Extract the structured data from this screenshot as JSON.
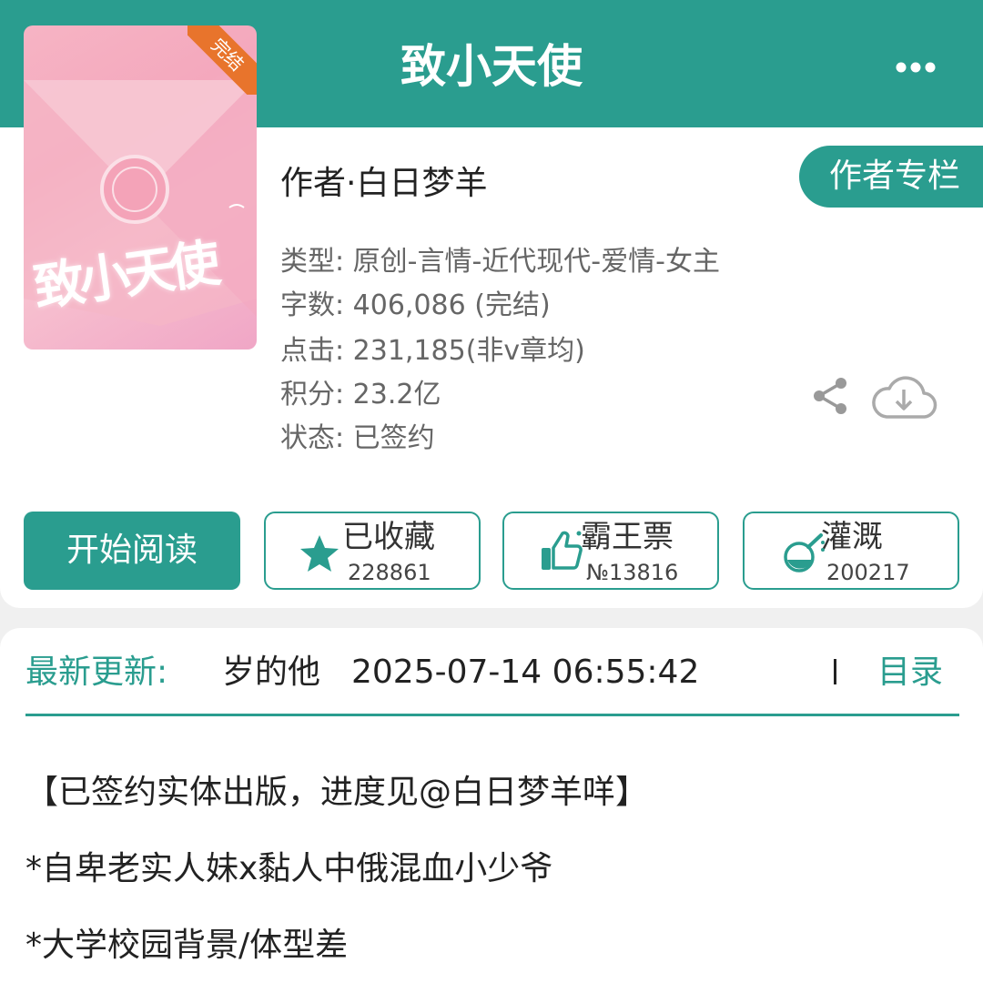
{
  "header": {
    "title": "致小天使"
  },
  "book": {
    "cover": {
      "ribbon": "完结",
      "title_art": "致小天使"
    },
    "author_line": "作者·白日梦羊",
    "author_column_button": "作者专栏",
    "meta": [
      "类型: 原创-言情-近代现代-爱情-女主",
      "字数: 406,086 (完结)",
      "点击: 231,185(非v章均)",
      "积分: 23.2亿",
      "状态: 已签约"
    ]
  },
  "actions": {
    "read_label": "开始阅读",
    "favorite": {
      "label": "已收藏",
      "count": "228861"
    },
    "vote": {
      "label": "霸王票",
      "count": "№13816"
    },
    "water": {
      "label": "灌溉",
      "count": "200217"
    }
  },
  "latest": {
    "label": "最新更新:",
    "chapter": "岁的他",
    "time": "2025-07-14 06:55:42",
    "toc_label": "目录"
  },
  "description": [
    "【已签约实体出版，进度见@白日梦羊咩】",
    "*自卑老实人妹x黏人中俄混血小少爷",
    "*大学校园背景/体型差"
  ],
  "colors": {
    "accent": "#2a9d8f",
    "ribbon": "#e8742c"
  },
  "icons": [
    "back-arrow-icon",
    "more-dots-icon",
    "share-icon",
    "cloud-download-icon",
    "star-icon",
    "thumbs-up-icon",
    "flask-icon"
  ]
}
